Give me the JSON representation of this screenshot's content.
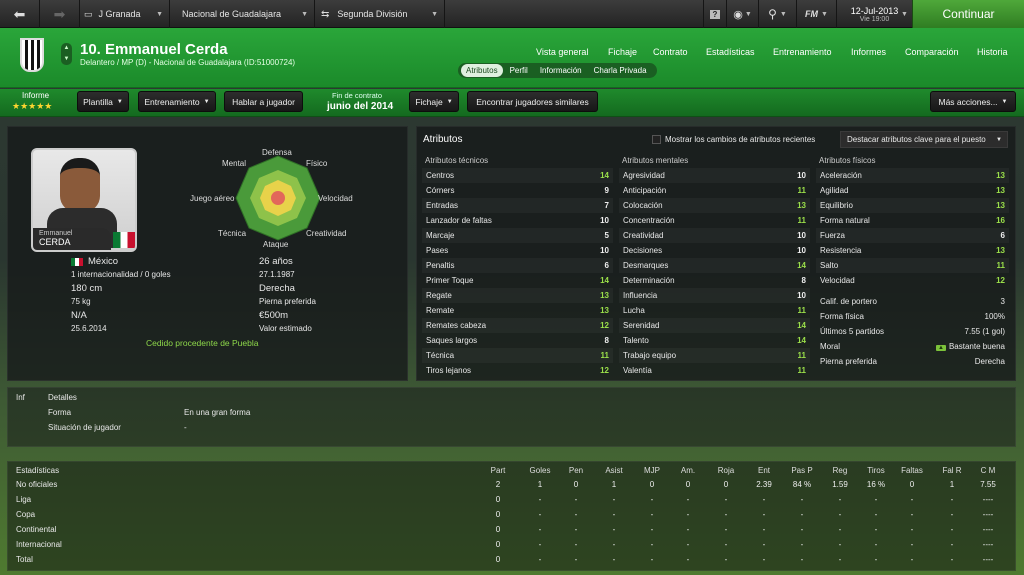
{
  "topbar": {
    "team1": "J Granada",
    "team2": "Nacional de Guadalajara",
    "league": "Segunda División",
    "date": "12-Jul-2013",
    "time": "Vie 19:00",
    "fm": "FM",
    "continue": "Continuar"
  },
  "player": {
    "name": "10. Emmanuel Cerda",
    "subtitle": "Delantero / MP (D) - Nacional de Guadalajara (ID:51000724)",
    "card_first": "Emmanuel",
    "card_last": "CERDA"
  },
  "nav": [
    "Vista general",
    "Fichaje",
    "Contrato",
    "Estadísticas",
    "Entrenamiento",
    "Informes",
    "Comparación",
    "Historia"
  ],
  "subnav": [
    "Atributos",
    "Perfil",
    "Información",
    "Charla Privada"
  ],
  "actions": {
    "report_label": "Informe",
    "stars": "★★★★★",
    "squad": "Plantilla",
    "training": "Entrenamiento",
    "talk": "Hablar a jugador",
    "contract_label": "Fin de contrato",
    "contract_date": "junio del 2014",
    "transfer": "Fichaje",
    "similar": "Encontrar jugadores similares",
    "more": "Más acciones..."
  },
  "radar": {
    "defensa": "Defensa",
    "fisico": "Físico",
    "mental": "Mental",
    "velocidad": "Velocidad",
    "juego_aereo": "Juego aéreo",
    "creatividad": "Creatividad",
    "tecnica": "Técnica",
    "ataque": "Ataque"
  },
  "profile": {
    "nation": "México",
    "age": "26 años",
    "caps": "1 internacionalidad / 0 goles",
    "dob": "27.1.1987",
    "height": "180 cm",
    "foot": "Derecha",
    "weight": "75 kg",
    "foot_label": "Pierna preferida",
    "na": "N/A",
    "value": "€500m",
    "date2": "25.6.2014",
    "value_label": "Valor estimado",
    "loan": "Cedido procedente de Puebla"
  },
  "attributes": {
    "title": "Atributos",
    "show_changes": "Mostrar los cambios de atributos recientes",
    "highlight": "Destacar atributos clave para el puesto",
    "tech_title": "Atributos técnicos",
    "mental_title": "Atributos mentales",
    "phys_title": "Atributos físicos",
    "technical": [
      [
        "Centros",
        "14"
      ],
      [
        "Córners",
        "9"
      ],
      [
        "Entradas",
        "7"
      ],
      [
        "Lanzador de faltas",
        "10"
      ],
      [
        "Marcaje",
        "5"
      ],
      [
        "Pases",
        "10"
      ],
      [
        "Penaltis",
        "6"
      ],
      [
        "Primer Toque",
        "14"
      ],
      [
        "Regate",
        "13"
      ],
      [
        "Remate",
        "13"
      ],
      [
        "Remates cabeza",
        "12"
      ],
      [
        "Saques largos",
        "8"
      ],
      [
        "Técnica",
        "11"
      ],
      [
        "Tiros lejanos",
        "12"
      ]
    ],
    "mental": [
      [
        "Agresividad",
        "10"
      ],
      [
        "Anticipación",
        "11"
      ],
      [
        "Colocación",
        "13"
      ],
      [
        "Concentración",
        "11"
      ],
      [
        "Creatividad",
        "10"
      ],
      [
        "Decisiones",
        "10"
      ],
      [
        "Desmarques",
        "14"
      ],
      [
        "Determinación",
        "8"
      ],
      [
        "Influencia",
        "10"
      ],
      [
        "Lucha",
        "11"
      ],
      [
        "Serenidad",
        "14"
      ],
      [
        "Talento",
        "14"
      ],
      [
        "Trabajo equipo",
        "11"
      ],
      [
        "Valentía",
        "11"
      ]
    ],
    "physical": [
      [
        "Aceleración",
        "13"
      ],
      [
        "Agilidad",
        "13"
      ],
      [
        "Equilibrio",
        "13"
      ],
      [
        "Forma natural",
        "16"
      ],
      [
        "Fuerza",
        "6"
      ],
      [
        "Resistencia",
        "13"
      ],
      [
        "Salto",
        "11"
      ],
      [
        "Velocidad",
        "12"
      ]
    ],
    "extra": [
      [
        "Calif. de portero",
        "3"
      ],
      [
        "Forma física",
        "100%"
      ],
      [
        "Últimos 5 partidos",
        "7.55 (1 gol)"
      ],
      [
        "Moral",
        "Bastante buena"
      ],
      [
        "Pierna preferida",
        "Derecha"
      ]
    ]
  },
  "details": {
    "tab1": "Inf",
    "tab2": "Detalles",
    "forma_label": "Forma",
    "forma_value": "En una gran forma",
    "situ_label": "Situación de jugador",
    "situ_value": "-"
  },
  "stats": {
    "title": "Estadísticas",
    "headers": [
      "Part",
      "Goles",
      "Pen",
      "Asist",
      "MJP",
      "Am.",
      "Roja",
      "Ent",
      "Pas P",
      "Reg",
      "Tiros",
      "Faltas",
      "Fal R",
      "C M"
    ],
    "rows": [
      {
        "label": "No oficiales",
        "cells": [
          "2",
          "1",
          "0",
          "1",
          "0",
          "0",
          "0",
          "2.39",
          "84 %",
          "1.59",
          "16 %",
          "0",
          "1",
          "7.55"
        ]
      },
      {
        "label": "Liga",
        "cells": [
          "0",
          "-",
          "-",
          "-",
          "-",
          "-",
          "-",
          "-",
          "-",
          "-",
          "-",
          "-",
          "-",
          "----"
        ]
      },
      {
        "label": "Copa",
        "cells": [
          "0",
          "-",
          "-",
          "-",
          "-",
          "-",
          "-",
          "-",
          "-",
          "-",
          "-",
          "-",
          "-",
          "----"
        ]
      },
      {
        "label": "Continental",
        "cells": [
          "0",
          "-",
          "-",
          "-",
          "-",
          "-",
          "-",
          "-",
          "-",
          "-",
          "-",
          "-",
          "-",
          "----"
        ]
      },
      {
        "label": "Internacional",
        "cells": [
          "0",
          "-",
          "-",
          "-",
          "-",
          "-",
          "-",
          "-",
          "-",
          "-",
          "-",
          "-",
          "-",
          "----"
        ]
      },
      {
        "label": "Total",
        "cells": [
          "0",
          "-",
          "-",
          "-",
          "-",
          "-",
          "-",
          "-",
          "-",
          "-",
          "-",
          "-",
          "-",
          "----"
        ]
      }
    ]
  }
}
